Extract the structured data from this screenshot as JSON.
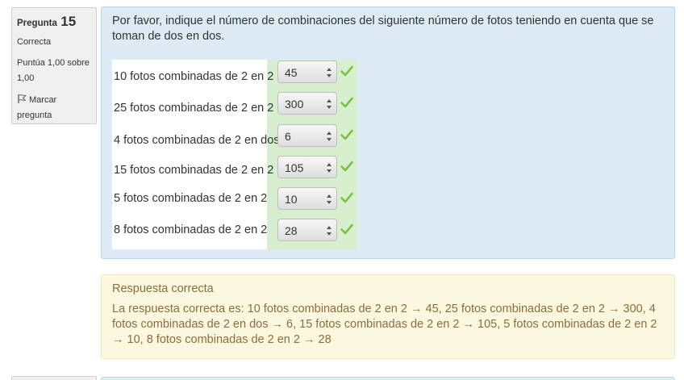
{
  "question": {
    "number_label": "Pregunta",
    "number": "15",
    "state": "Correcta",
    "grade": "Puntúa 1,00 sobre 1,00",
    "flag_label": "Marcar pregunta",
    "text": "Por favor, indique el número de combinaciones del siguiente número de fotos teniendo en cuenta que se toman de dos en dos."
  },
  "rows": [
    {
      "label": "10 fotos combinadas de 2 en 2",
      "value": "45",
      "status": "correct"
    },
    {
      "label": "25 fotos combinadas de 2 en 2",
      "value": "300",
      "status": "correct"
    },
    {
      "label": "4 fotos combinadas de 2 en dos",
      "value": "6",
      "status": "correct"
    },
    {
      "label": "15 fotos combinadas de 2 en 2",
      "value": "105",
      "status": "correct"
    },
    {
      "label": "5 fotos combinadas de 2 en 2",
      "value": "10",
      "status": "correct"
    },
    {
      "label": "8 fotos combinadas de 2 en 2",
      "value": "28",
      "status": "correct"
    }
  ],
  "feedback": {
    "title": "Respuesta correcta",
    "text": "La respuesta correcta es: 10 fotos combinadas de 2 en 2 → 45, 25 fotos combinadas de 2 en 2 → 300, 4 fotos combinadas de 2 en dos → 6, 15 fotos combinadas de 2 en 2 → 105, 5 fotos combinadas de 2 en 2 → 10, 8 fotos combinadas de 2 en 2 → 28"
  },
  "icons": {
    "check": "check-icon",
    "flag": "flag-icon",
    "select_arrows": "updown-arrows-icon"
  },
  "colors": {
    "info_bg": "#f0f0f0",
    "question_bg": "#dcebf4",
    "correct_bg": "#d7efcf",
    "check": "#7bc142",
    "feedback_bg": "#fcf8e0",
    "feedback_text": "#8a6d3b"
  }
}
